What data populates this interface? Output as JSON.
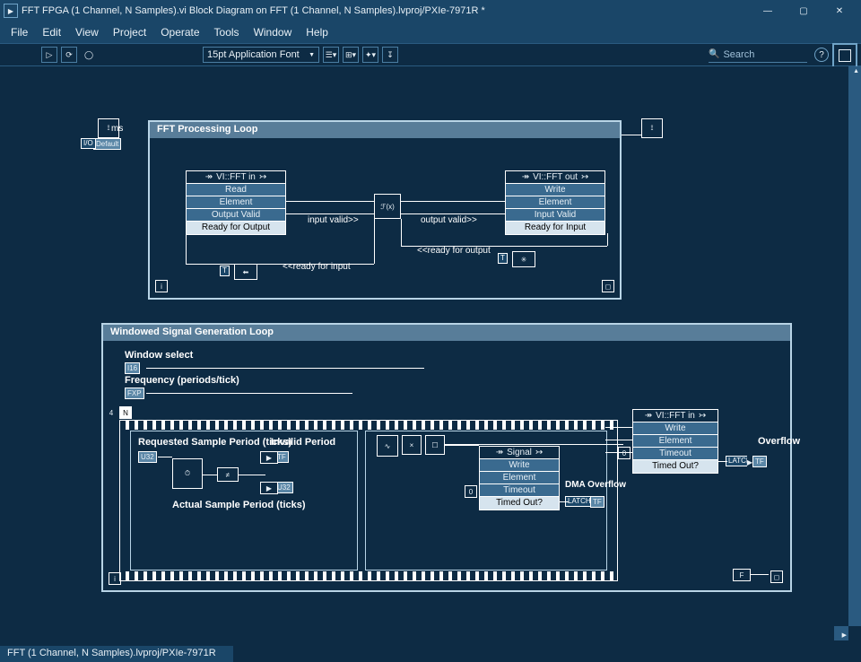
{
  "window": {
    "title": "FFT FPGA (1 Channel, N Samples).vi Block Diagram on FFT (1 Channel, N Samples).lvproj/PXIe-7971R *"
  },
  "menu": [
    "File",
    "Edit",
    "View",
    "Project",
    "Operate",
    "Tools",
    "Window",
    "Help"
  ],
  "toolbar": {
    "font": "15pt Application Font",
    "search_placeholder": "Search"
  },
  "canvas": {
    "timer_label": "ms",
    "timer_val": "Default",
    "loop1": {
      "title": "FFT Processing Loop",
      "in_node": {
        "name": "VI::FFT in",
        "rows": [
          "Read",
          "Element",
          "Output Valid",
          "Ready for Output"
        ]
      },
      "out_node": {
        "name": "VI::FFT out",
        "rows": [
          "Write",
          "Element",
          "Input Valid",
          "Ready for Input"
        ]
      },
      "wire_labels": {
        "iv": "input valid>>",
        "ov": "output valid>>",
        "rfo": "<<ready for output",
        "rfi": "<<ready for input"
      }
    },
    "loop2": {
      "title": "Windowed Signal Generation Loop",
      "window_select": "Window select",
      "freq": "Frequency (periods/tick)",
      "req_period": "Requested Sample Period (ticks)",
      "inv_period": "Invalid Period",
      "act_period": "Actual Sample Period (ticks)",
      "signal_node": {
        "name": "Signal",
        "rows": [
          "Write",
          "Element",
          "Timeout",
          "Timed Out?"
        ],
        "idx": "0"
      },
      "dma": "DMA Overflow",
      "latch": "LATCH",
      "fft_in_node": {
        "name": "VI::FFT in",
        "rows": [
          "Write",
          "Element",
          "Timeout",
          "Timed Out?"
        ],
        "idx": "0"
      },
      "overflow": "Overflow",
      "n_label": "N",
      "four_label": "4",
      "u32": "U32",
      "fxp": "FXP",
      "i16": "I16",
      "tf": "TF",
      "i": "i"
    }
  },
  "status": "FFT (1 Channel, N Samples).lvproj/PXIe-7971R"
}
